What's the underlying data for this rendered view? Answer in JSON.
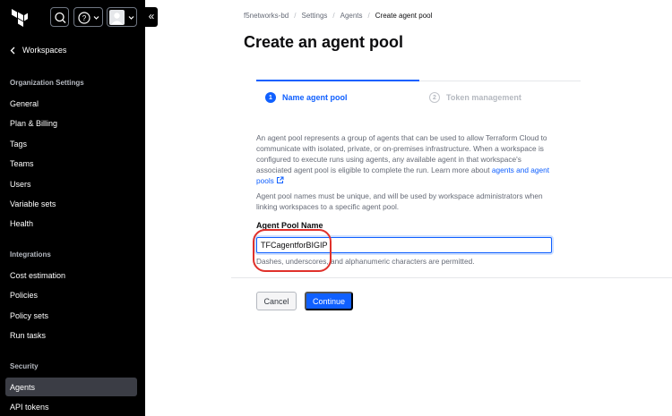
{
  "sidebar": {
    "back_label": "Workspaces",
    "org_settings_title": "Organization Settings",
    "org_items": [
      "General",
      "Plan & Billing",
      "Tags",
      "Teams",
      "Users",
      "Variable sets",
      "Health"
    ],
    "integrations_title": "Integrations",
    "integration_items": [
      "Cost estimation",
      "Policies",
      "Policy sets",
      "Run tasks"
    ],
    "security_title": "Security",
    "security_items": [
      "Agents",
      "API tokens"
    ],
    "active_item": "Agents"
  },
  "breadcrumb": {
    "org": "f5networks-bd",
    "settings": "Settings",
    "agents": "Agents",
    "current": "Create agent pool",
    "separator": "/"
  },
  "page": {
    "title": "Create an agent pool"
  },
  "steps": [
    {
      "number": "1",
      "label": "Name agent pool",
      "active": true
    },
    {
      "number": "2",
      "label": "Token management",
      "active": false
    }
  ],
  "description": {
    "text": "An agent pool represents a group of agents that can be used to allow Terraform Cloud to communicate with isolated, private, or on-premises infrastructure. When a workspace is configured to execute runs using agents, any available agent in that workspace's associated agent pool is eligible to complete the run. Learn more about",
    "link": "agents and agent pools",
    "note": "Agent pool names must be unique, and will be used by workspace administrators when linking workspaces to a specific agent pool."
  },
  "form": {
    "label": "Agent Pool Name",
    "value": "TFCagentforBIGIP",
    "hint": "Dashes, underscores, and alphanumeric characters are permitted."
  },
  "actions": {
    "cancel": "Cancel",
    "continue": "Continue"
  },
  "colors": {
    "accent": "#1060ff",
    "sidebar_bg": "#000000",
    "highlight": "#e0312b"
  }
}
